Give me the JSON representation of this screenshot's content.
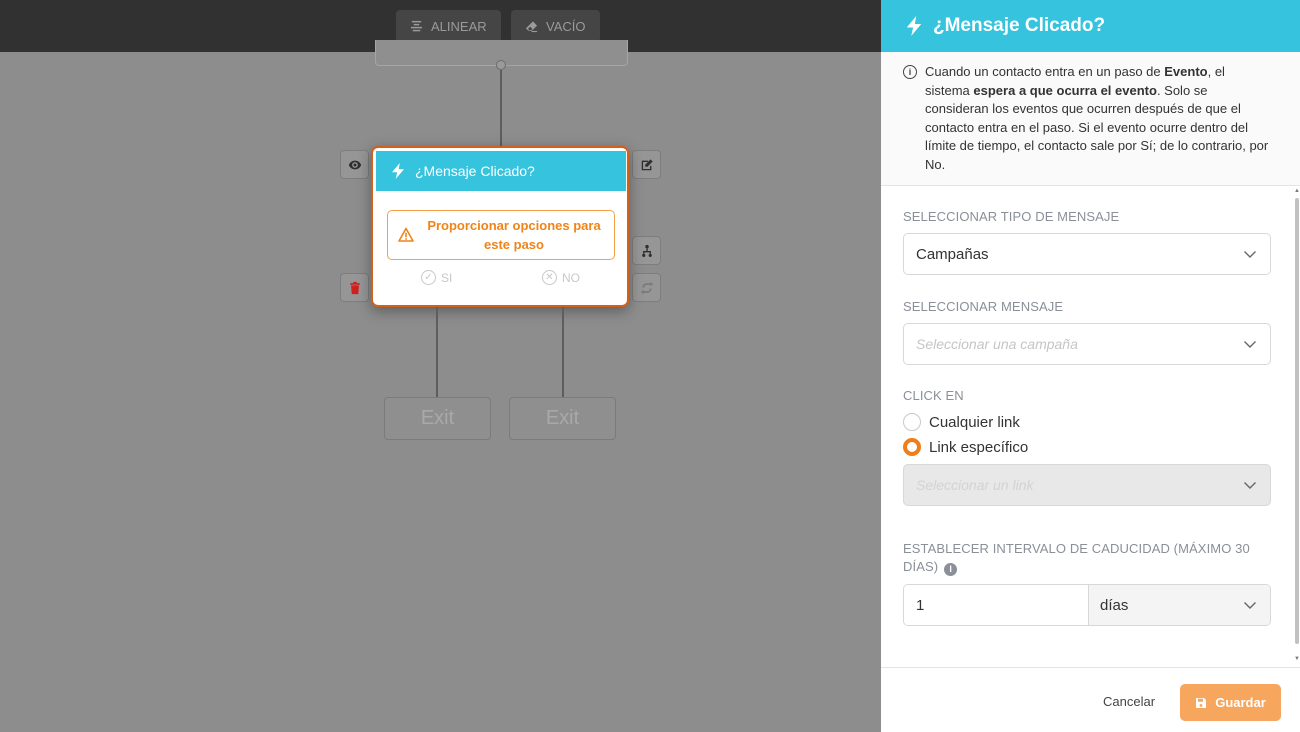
{
  "toolbar": {
    "align_label": "ALINEAR",
    "empty_label": "VACÍO"
  },
  "node": {
    "title": "¿Mensaje Clicado?",
    "warning": "Proporcionar opciones para este paso",
    "yes_label": "SI",
    "no_label": "NO"
  },
  "exits": [
    "Exit",
    "Exit"
  ],
  "panel": {
    "title": "¿Mensaje Clicado?",
    "info": {
      "p1": "Cuando un contacto entra en un paso de ",
      "b1": "Evento",
      "p2": ", el sistema ",
      "b2": "espera a que ocurra el evento",
      "p3": ". Solo se consideran los eventos que ocurren después de que el contacto entra en el paso. Si el evento ocurre dentro del límite de tiempo, el contacto sale por Sí; de lo contrario, por No."
    },
    "message_type_label": "SELECCIONAR TIPO DE MENSAJE",
    "message_type_value": "Campañas",
    "message_label": "SELECCIONAR MENSAJE",
    "message_placeholder": "Seleccionar una campaña",
    "click_label": "CLICK EN",
    "radio_any": "Cualquier link",
    "radio_specific": "Link específico",
    "selected_radio": "Link específico",
    "link_placeholder": "Seleccionar un link",
    "interval_label": "ESTABLECER INTERVALO DE CADUCIDAD (MÁXIMO 30 DÍAS)",
    "interval_value": "1",
    "interval_unit": "días",
    "cancel_label": "Cancelar",
    "save_label": "Guardar"
  },
  "colors": {
    "accent": "#36c3de",
    "node_border": "#d4611a",
    "warning": "#f08418",
    "radio_selected": "#ef7d1a",
    "save_button": "#f7a65d"
  },
  "icons": [
    "align-icon",
    "eraser-icon",
    "lightning-icon",
    "eye-icon",
    "edit-icon",
    "delete-icon",
    "split-icon",
    "swap-icon",
    "warning-icon",
    "check-circle-icon",
    "x-circle-icon",
    "info-icon",
    "chevron-down-icon",
    "save-icon"
  ]
}
